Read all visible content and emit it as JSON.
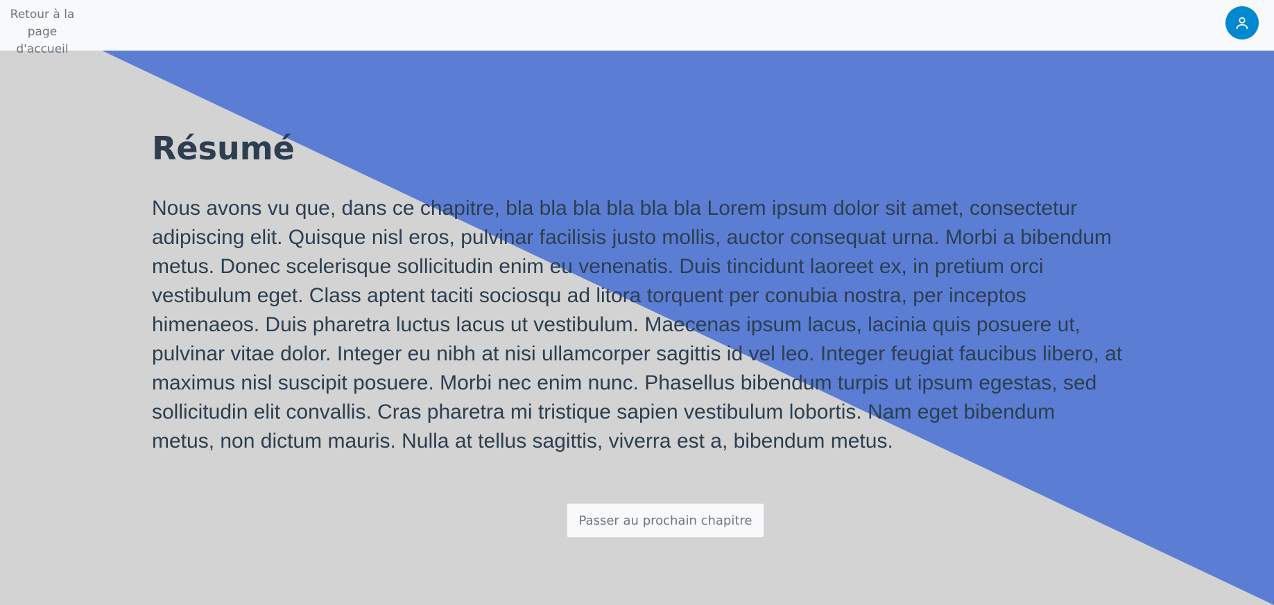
{
  "header": {
    "back_link_label": "Retour à la page d'accueil",
    "profile_icon": "user-icon"
  },
  "main": {
    "title": "Résumé",
    "summary": "Nous avons vu que, dans ce chapitre, bla bla bla bla bla bla Lorem ipsum dolor sit amet, consectetur adipiscing elit. Quisque nisl eros, pulvinar facilisis justo mollis, auctor consequat urna. Morbi a bibendum metus. Donec scelerisque sollicitudin enim eu venenatis. Duis tincidunt laoreet ex, in pretium orci vestibulum eget. Class aptent taciti sociosqu ad litora torquent per conubia nostra, per inceptos himenaeos. Duis pharetra luctus lacus ut vestibulum. Maecenas ipsum lacus, lacinia quis posuere ut, pulvinar vitae dolor. Integer eu nibh at nisi ullamcorper sagittis id vel leo. Integer feugiat faucibus libero, at maximus nisl suscipit posuere. Morbi nec enim nunc. Phasellus bibendum turpis ut ipsum egestas, sed sollicitudin elit convallis. Cras pharetra mi tristique sapien vestibulum lobortis. Nam eget bibendum metus, non dictum mauris. Nulla at tellus sagittis, viverra est a, bibendum metus.",
    "next_button_label": "Passer au prochain chapitre"
  },
  "colors": {
    "background": "#d3d3d3",
    "accent_blue": "#5b7ed4",
    "header_bg": "#f8f9fa",
    "avatar_bg": "#0288d1",
    "text_dark": "#2c3e50",
    "text_muted": "#6c757d"
  }
}
